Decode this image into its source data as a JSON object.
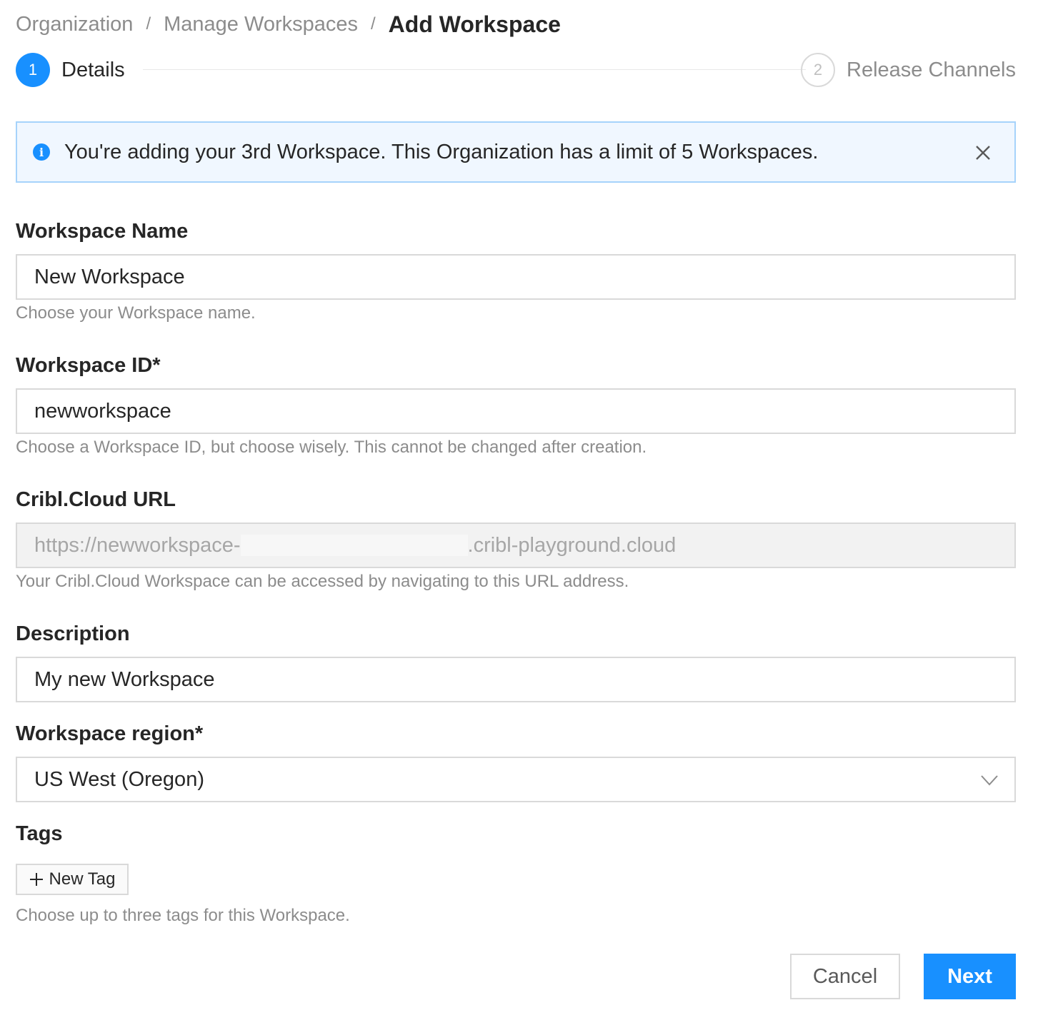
{
  "breadcrumb": {
    "items": [
      "Organization",
      "Manage Workspaces"
    ],
    "separator": "/",
    "current": "Add Workspace"
  },
  "steps": [
    {
      "number": "1",
      "label": "Details",
      "state": "active"
    },
    {
      "number": "2",
      "label": "Release Channels",
      "state": "inactive"
    }
  ],
  "alert": {
    "icon": "info-icon",
    "icon_glyph": "i",
    "text": "You're adding your 3rd Workspace. This Organization has a limit of 5 Workspaces."
  },
  "form": {
    "workspace_name": {
      "label": "Workspace Name",
      "value": "New Workspace",
      "help": "Choose your Workspace name."
    },
    "workspace_id": {
      "label": "Workspace ID*",
      "value": "newworkspace",
      "help": "Choose a Workspace ID, but choose wisely. This cannot be changed after creation."
    },
    "cloud_url": {
      "label": "Cribl.Cloud URL",
      "value_prefix": "https://newworkspace-",
      "value_suffix": ".cribl-playground.cloud",
      "help": "Your Cribl.Cloud Workspace can be accessed by navigating to this URL address."
    },
    "description": {
      "label": "Description",
      "value": "My new Workspace"
    },
    "region": {
      "label": "Workspace region*",
      "value": "US West (Oregon)"
    },
    "tags": {
      "label": "Tags",
      "button": "New Tag",
      "help": "Choose up to three tags for this Workspace."
    }
  },
  "actions": {
    "cancel": "Cancel",
    "next": "Next"
  },
  "colors": {
    "primary": "#1890ff",
    "alert_bg": "#f0f7ff",
    "alert_border": "#a6d3fb"
  }
}
